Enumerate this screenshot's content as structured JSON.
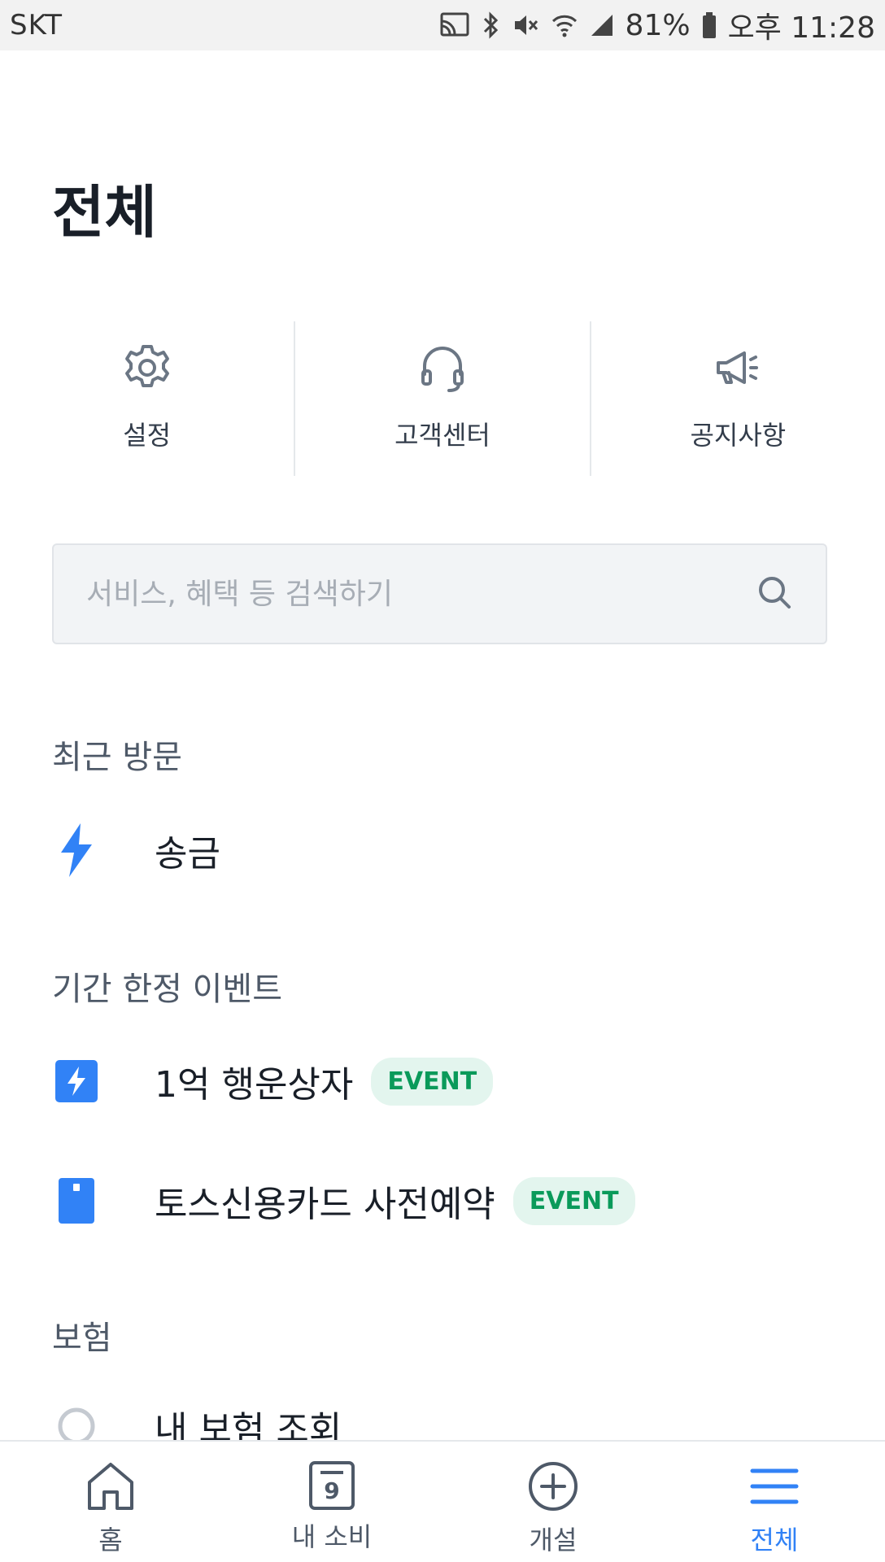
{
  "status_bar": {
    "carrier": "SKT",
    "battery": "81%",
    "time": "오후 11:28"
  },
  "page": {
    "title": "전체"
  },
  "quick_menu": [
    {
      "label": "설정",
      "icon": "gear-icon"
    },
    {
      "label": "고객센터",
      "icon": "headset-icon"
    },
    {
      "label": "공지사항",
      "icon": "megaphone-icon"
    }
  ],
  "search": {
    "placeholder": "서비스, 혜택 등 검색하기",
    "value": ""
  },
  "sections": {
    "recent": {
      "title": "최근 방문",
      "items": [
        {
          "label": "송금",
          "icon": "lightning-icon"
        }
      ]
    },
    "events": {
      "title": "기간 한정 이벤트",
      "items": [
        {
          "label": "1억 행운상자",
          "badge": "EVENT",
          "icon": "lightning-box-icon"
        },
        {
          "label": "토스신용카드 사전예약",
          "badge": "EVENT",
          "icon": "card-icon"
        }
      ]
    },
    "insurance": {
      "title": "보험",
      "items": [
        {
          "label": "내 보험 조회",
          "icon": "circle-icon"
        }
      ]
    }
  },
  "tab_bar": {
    "tabs": [
      {
        "label": "홈",
        "icon": "home-icon"
      },
      {
        "label": "내 소비",
        "icon": "calendar-icon",
        "icon_text": "9"
      },
      {
        "label": "개설",
        "icon": "plus-circle-icon"
      },
      {
        "label": "전체",
        "icon": "menu-icon",
        "active": true
      }
    ]
  },
  "colors": {
    "accent": "#3182f6",
    "event_badge_bg": "#e3f5ee",
    "event_badge_text": "#0a9a5a"
  }
}
